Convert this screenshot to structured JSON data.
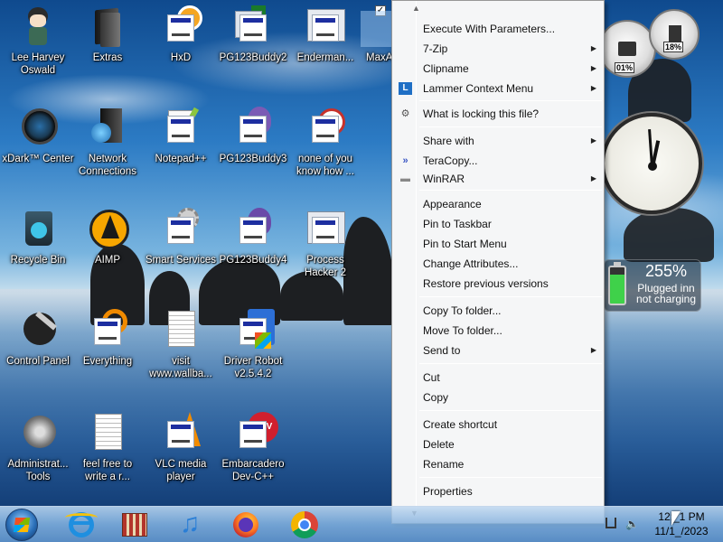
{
  "desktop_icons": [
    {
      "label": "Lee Harvey\nOswald"
    },
    {
      "label": "Extras"
    },
    {
      "label": "HxD"
    },
    {
      "label": "PG123Buddy2"
    },
    {
      "label": "Enderman..."
    },
    {
      "label": "MaxA"
    },
    {
      "label": "xDark™ Center"
    },
    {
      "label": "Network\nConnections"
    },
    {
      "label": "Notepad++"
    },
    {
      "label": "PG123Buddy3"
    },
    {
      "label": "none of you\nknow how ..."
    },
    {
      "label": "Recycle Bin"
    },
    {
      "label": "AIMP"
    },
    {
      "label": "Smart Services"
    },
    {
      "label": "PG123Buddy4"
    },
    {
      "label": "Process\nHacker 2"
    },
    {
      "label": "Control Panel"
    },
    {
      "label": "Everything"
    },
    {
      "label": "visit\nwww.wallba..."
    },
    {
      "label": "Driver Robot\nv2.5.4.2"
    },
    {
      "label": "Administrat...\nTools"
    },
    {
      "label": "feel free to\nwrite a r..."
    },
    {
      "label": "VLC media\nplayer"
    },
    {
      "label": "Embarcadero\nDev-C++"
    }
  ],
  "context_menu": {
    "items": [
      {
        "label": "Execute With Parameters...",
        "submenu": false
      },
      {
        "label": "7-Zip",
        "submenu": true
      },
      {
        "label": "Clipname",
        "submenu": true
      },
      {
        "label": "Lammer Context Menu",
        "submenu": true,
        "icon": "lammer-icon"
      },
      {
        "label": "What is locking this file?",
        "submenu": false,
        "icon": "magnifier-gear-icon"
      },
      {
        "label": "Share with",
        "submenu": true
      },
      {
        "label": "TeraCopy...",
        "submenu": false,
        "icon": "teracopy-icon"
      },
      {
        "label": "WinRAR",
        "submenu": true,
        "icon": "winrar-icon"
      },
      {
        "label": "Appearance",
        "submenu": false
      },
      {
        "label": "Pin to Taskbar",
        "submenu": false
      },
      {
        "label": "Pin to Start Menu",
        "submenu": false
      },
      {
        "label": "Change Attributes...",
        "submenu": false
      },
      {
        "label": "Restore previous versions",
        "submenu": false
      },
      {
        "label": "Copy To folder...",
        "submenu": false
      },
      {
        "label": "Move To folder...",
        "submenu": false
      },
      {
        "label": "Send to",
        "submenu": true
      },
      {
        "label": "Cut",
        "submenu": false
      },
      {
        "label": "Copy",
        "submenu": false
      },
      {
        "label": "Create shortcut",
        "submenu": false
      },
      {
        "label": "Delete",
        "submenu": false
      },
      {
        "label": "Rename",
        "submenu": false
      },
      {
        "label": "Properties",
        "submenu": false
      }
    ]
  },
  "gadgets": {
    "cpu_meter": {
      "percent_a": "01%",
      "percent_b": "18%"
    },
    "battery": {
      "percent": "255%",
      "status_line1": "Plugged inn",
      "status_line2": "not charging"
    }
  },
  "taskbar": {
    "pinned": [
      "start-orb-icon",
      "internet-explorer-icon",
      "app-icon",
      "itunes-icon",
      "firefox-icon",
      "chrome-icon"
    ],
    "clock_time": "12:_1 PM",
    "clock_date": "11/1_/2023"
  },
  "colors": {
    "menu_bg": "#f5f6f7",
    "taskbar": "#82afdc",
    "battery_green": "#3fd14a"
  }
}
